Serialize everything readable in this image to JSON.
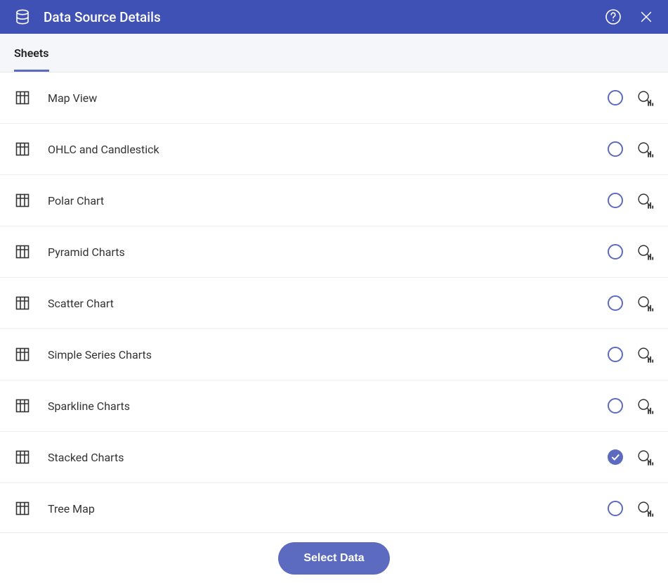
{
  "header": {
    "title": "Data Source Details"
  },
  "tabs": {
    "active": "Sheets"
  },
  "sheets": [
    {
      "label": "Map View",
      "selected": false
    },
    {
      "label": "OHLC and Candlestick",
      "selected": false
    },
    {
      "label": "Polar Chart",
      "selected": false
    },
    {
      "label": "Pyramid Charts",
      "selected": false
    },
    {
      "label": "Scatter Chart",
      "selected": false
    },
    {
      "label": "Simple Series Charts",
      "selected": false
    },
    {
      "label": "Sparkline Charts",
      "selected": false
    },
    {
      "label": "Stacked Charts",
      "selected": true
    },
    {
      "label": "Tree Map",
      "selected": false
    }
  ],
  "footer": {
    "select_label": "Select Data"
  }
}
